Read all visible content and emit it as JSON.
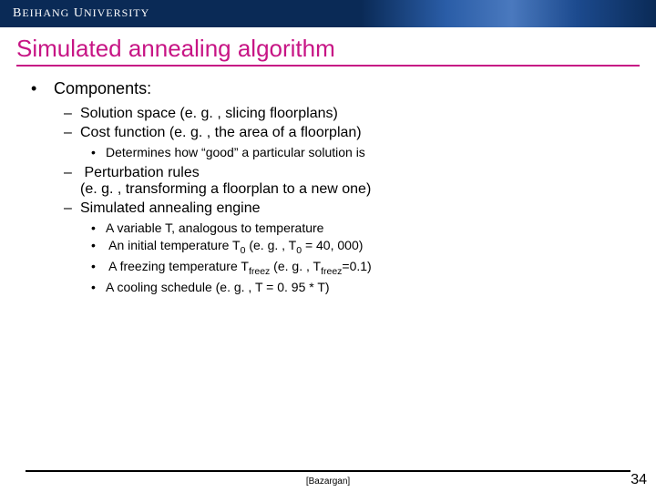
{
  "banner": {
    "prefix": "B",
    "rest": "EIHANG",
    "prefix2": "U",
    "rest2": "NIVERSITY"
  },
  "title": "Simulated annealing algorithm",
  "h1": "Components:",
  "c1": "Solution space (e. g. , slicing floorplans)",
  "c2": "Cost function (e. g. , the area of a floorplan)",
  "c2a": "Determines how “good” a particular solution is",
  "c3a": "Perturbation rules",
  "c3b": "(e. g. , transforming a floorplan to a new one)",
  "c4": "Simulated annealing engine",
  "c4a": "A variable T, analogous to temperature",
  "c4b_1": "An initial temperature T",
  "c4b_sub": "0",
  "c4b_2": " (e. g. , T",
  "c4b_3": " = 40, 000)",
  "c4c_1": "A freezing temperature T",
  "c4c_sub": "freez",
  "c4c_2": " (e. g. , T",
  "c4c_3": "=0.1)",
  "c4d": "A cooling schedule (e. g. , T = 0. 95 * T)",
  "cite": "[Bazargan]",
  "page": "34"
}
